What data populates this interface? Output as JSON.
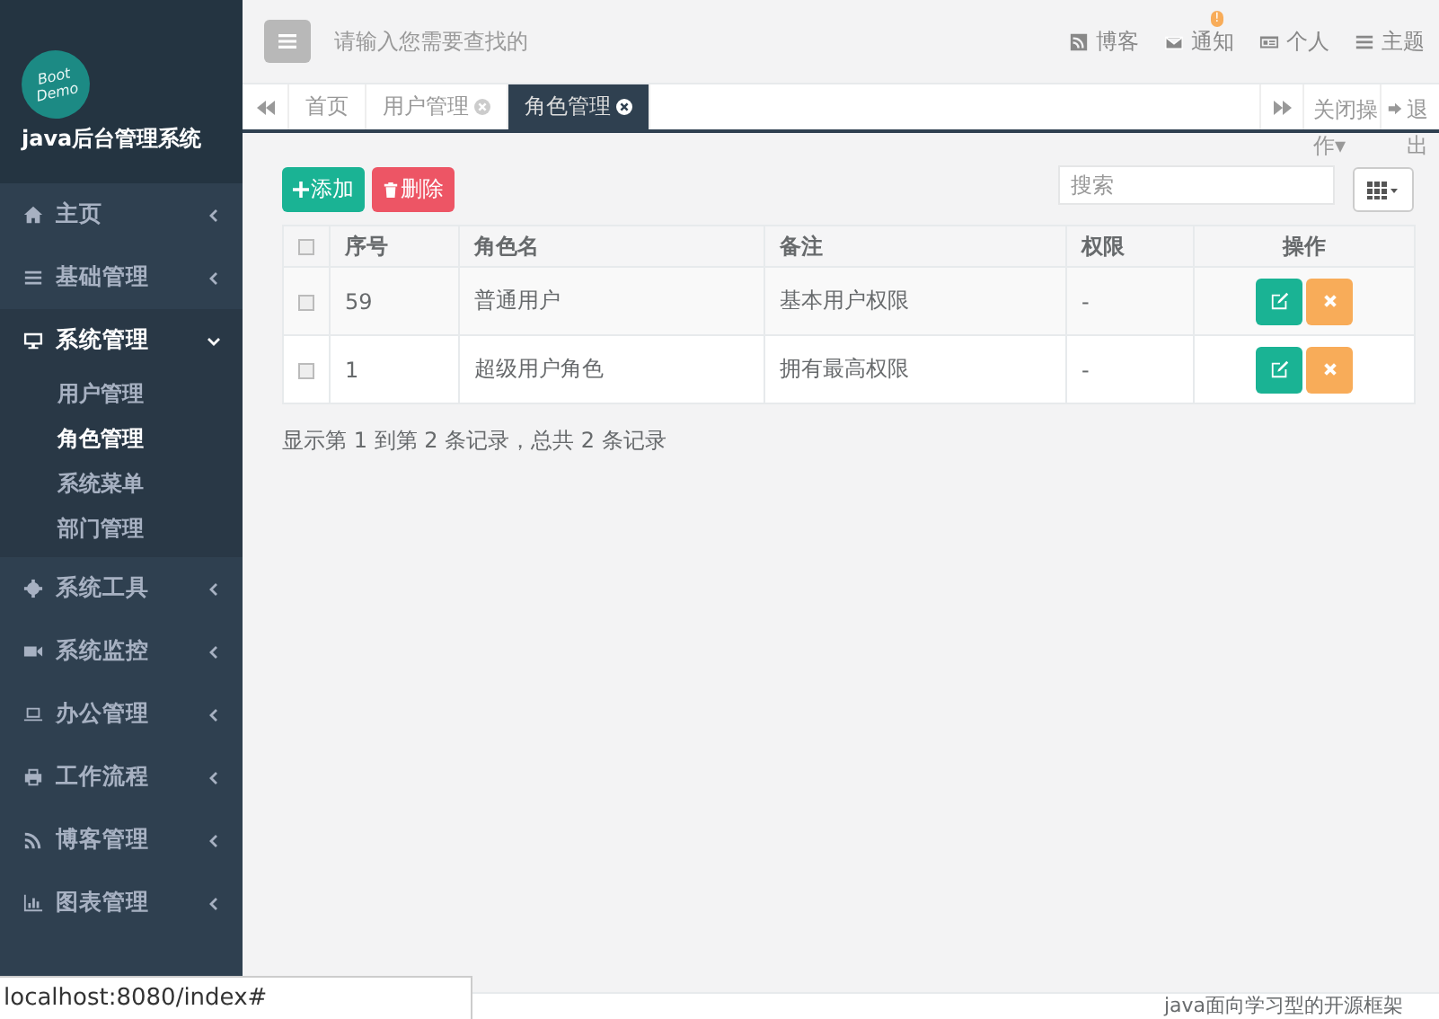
{
  "sidebar": {
    "logo_lines": [
      "Boot",
      "Demo"
    ],
    "title": "java后台管理系统",
    "items": [
      {
        "label": "主页",
        "expanded": false
      },
      {
        "label": "基础管理",
        "expanded": false
      },
      {
        "label": "系统管理",
        "expanded": true,
        "children": [
          {
            "label": "用户管理",
            "selected": false
          },
          {
            "label": "角色管理",
            "selected": true
          },
          {
            "label": "系统菜单",
            "selected": false
          },
          {
            "label": "部门管理",
            "selected": false
          }
        ]
      },
      {
        "label": "系统工具",
        "expanded": false
      },
      {
        "label": "系统监控",
        "expanded": false
      },
      {
        "label": "办公管理",
        "expanded": false
      },
      {
        "label": "工作流程",
        "expanded": false
      },
      {
        "label": "博客管理",
        "expanded": false
      },
      {
        "label": "图表管理",
        "expanded": false
      }
    ]
  },
  "header": {
    "search": {
      "placeholder": "请输入您需要查找的"
    },
    "links": [
      {
        "label": "博客"
      },
      {
        "label": "通知",
        "badge": "!"
      },
      {
        "label": "个人"
      },
      {
        "label": "主题"
      }
    ]
  },
  "tabs": [
    {
      "label": "首页",
      "closable": false,
      "selected": false
    },
    {
      "label": "用户管理",
      "closable": true,
      "selected": false
    },
    {
      "label": "角色管理",
      "closable": true,
      "selected": true
    }
  ],
  "tab_actions": {
    "close": "关闭操作▾",
    "exit": "退出"
  },
  "toolbar": {
    "add": "添加",
    "delete": "删除",
    "search": {
      "placeholder": "搜索"
    }
  },
  "table": {
    "select_all_checked": false,
    "columns": [
      "序号",
      "角色名",
      "备注",
      "权限",
      "操作"
    ],
    "rows": [
      {
        "checked": false,
        "id": "59",
        "name": "普通用户",
        "remark": "基本用户权限",
        "permission": "-"
      },
      {
        "checked": false,
        "id": "1",
        "name": "超级用户角色",
        "remark": "拥有最高权限",
        "permission": "-"
      }
    ]
  },
  "pagination": "显示第 1 到第 2 条记录，总共 2 条记录",
  "footer": "java面向学习型的开源框架",
  "status_bar": "localhost:8080/index#"
}
